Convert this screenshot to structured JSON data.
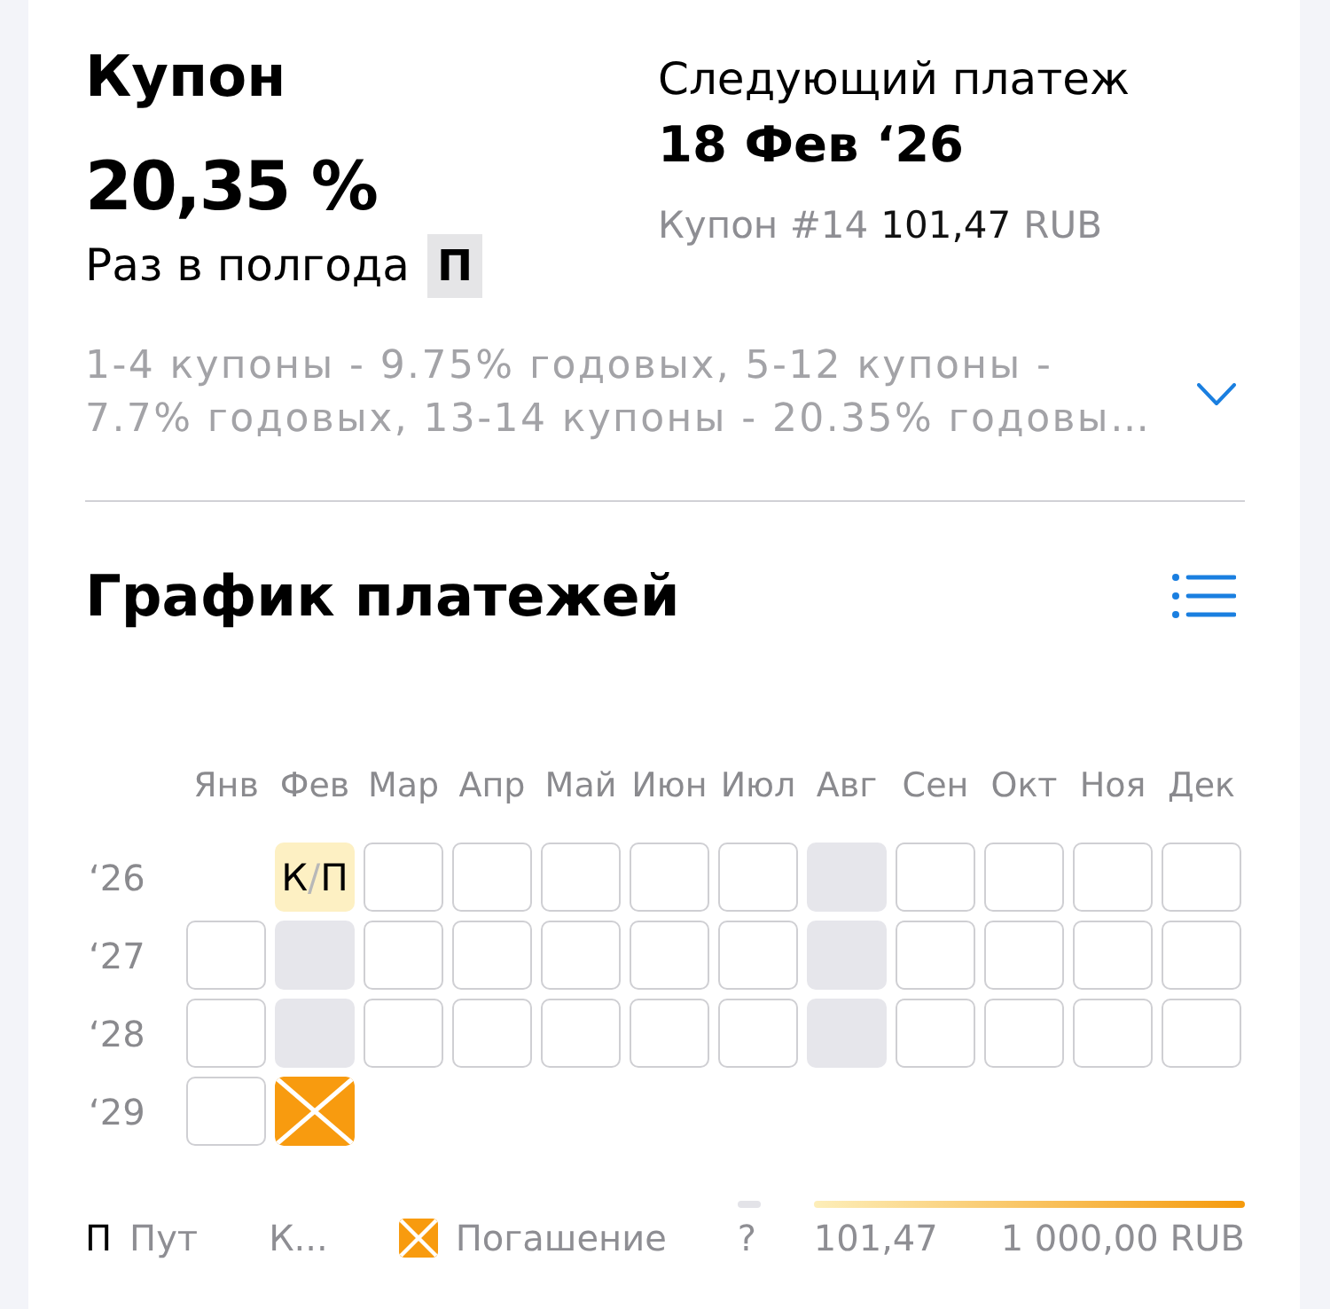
{
  "coupon": {
    "title": "Купон",
    "rate": "20,35 %",
    "frequency": "Раз в полгода",
    "badge": "П",
    "description": "1-4 купоны - 9.75% годовых, 5-12 купоны - 7.7% годовых, 13-14 купоны - 20.35% годовы…",
    "expanded": false
  },
  "next_payment": {
    "label": "Следующий платеж",
    "date": "18 Фев ‘26",
    "coupon_number": "Купон #14",
    "amount": "101,47",
    "currency": "RUB"
  },
  "schedule": {
    "title": "График платежей",
    "months": [
      "Янв",
      "Фев",
      "Мар",
      "Апр",
      "Май",
      "Июн",
      "Июл",
      "Авг",
      "Сен",
      "Окт",
      "Ноя",
      "Дек"
    ],
    "rows": [
      {
        "year": "‘26",
        "cells": [
          {
            "kind": "blank"
          },
          {
            "kind": "payment",
            "color": "#fdf0c3",
            "marks": [
              "К",
              "П"
            ],
            "separator": "/"
          },
          {
            "kind": "empty"
          },
          {
            "kind": "empty"
          },
          {
            "kind": "empty"
          },
          {
            "kind": "empty"
          },
          {
            "kind": "empty"
          },
          {
            "kind": "unknown"
          },
          {
            "kind": "empty"
          },
          {
            "kind": "empty"
          },
          {
            "kind": "empty"
          },
          {
            "kind": "empty"
          }
        ]
      },
      {
        "year": "‘27",
        "cells": [
          {
            "kind": "empty"
          },
          {
            "kind": "unknown"
          },
          {
            "kind": "empty"
          },
          {
            "kind": "empty"
          },
          {
            "kind": "empty"
          },
          {
            "kind": "empty"
          },
          {
            "kind": "empty"
          },
          {
            "kind": "unknown"
          },
          {
            "kind": "empty"
          },
          {
            "kind": "empty"
          },
          {
            "kind": "empty"
          },
          {
            "kind": "empty"
          }
        ]
      },
      {
        "year": "‘28",
        "cells": [
          {
            "kind": "empty"
          },
          {
            "kind": "unknown"
          },
          {
            "kind": "empty"
          },
          {
            "kind": "empty"
          },
          {
            "kind": "empty"
          },
          {
            "kind": "empty"
          },
          {
            "kind": "empty"
          },
          {
            "kind": "unknown"
          },
          {
            "kind": "empty"
          },
          {
            "kind": "empty"
          },
          {
            "kind": "empty"
          },
          {
            "kind": "empty"
          }
        ]
      },
      {
        "year": "‘29",
        "cells": [
          {
            "kind": "empty"
          },
          {
            "kind": "redemption",
            "color": "#f89b0f"
          }
        ]
      }
    ],
    "legend": [
      {
        "kind": "letter",
        "symbol": "П",
        "label": "Пут"
      },
      {
        "kind": "text",
        "label": "К..."
      },
      {
        "kind": "redemption",
        "label": "Погашение",
        "color": "#f89b0f"
      },
      {
        "kind": "unknown",
        "label": "?"
      },
      {
        "kind": "scale",
        "min_label": "101,47",
        "max_label": "1 000,00 RUB"
      }
    ]
  }
}
